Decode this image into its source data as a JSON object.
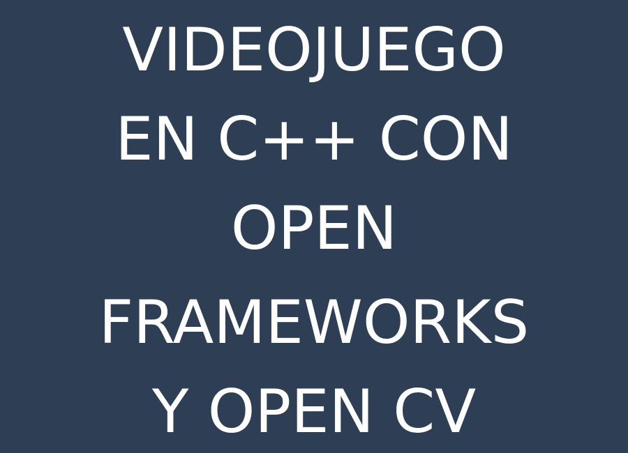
{
  "slide": {
    "title_lines": [
      "VIDEOJUEGO",
      "EN C++ CON",
      "OPEN",
      "FRAMEWORKS",
      "Y OPEN CV"
    ],
    "colors": {
      "background": "#2e3e54",
      "text": "#ffffff"
    }
  }
}
